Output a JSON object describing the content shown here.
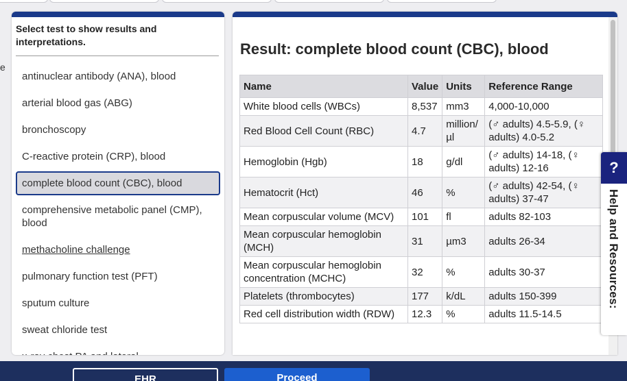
{
  "edge_glyph": "e",
  "left_panel": {
    "heading": "Select test to show results and interpretations.",
    "tests": [
      {
        "label": "antinuclear antibody (ANA), blood"
      },
      {
        "label": "arterial blood gas (ABG)"
      },
      {
        "label": "bronchoscopy"
      },
      {
        "label": "C-reactive protein (CRP), blood"
      },
      {
        "label": "complete blood count (CBC), blood",
        "selected": true
      },
      {
        "label": "comprehensive metabolic panel (CMP), blood"
      },
      {
        "label": "methacholine challenge",
        "underlined": true
      },
      {
        "label": "pulmonary function test (PFT)"
      },
      {
        "label": "sputum culture"
      },
      {
        "label": "sweat chloride test"
      },
      {
        "label": "x-ray chest PA and lateral"
      }
    ]
  },
  "result": {
    "title": "Result: complete blood count (CBC), blood",
    "columns": [
      "Name",
      "Value",
      "Units",
      "Reference Range"
    ],
    "rows": [
      {
        "name": "White blood cells (WBCs)",
        "value": "8,537",
        "units": "mm3",
        "range": "4,000-10,000"
      },
      {
        "name": "Red Blood Cell Count (RBC)",
        "value": "4.7",
        "units": "million/µl",
        "range": "(♂ adults) 4.5-5.9, (♀ adults) 4.0-5.2"
      },
      {
        "name": "Hemoglobin (Hgb)",
        "value": "18",
        "units": "g/dl",
        "range": "(♂ adults) 14-18, (♀ adults) 12-16"
      },
      {
        "name": "Hematocrit (Hct)",
        "value": "46",
        "units": "%",
        "range": "(♂ adults) 42-54, (♀ adults) 37-47"
      },
      {
        "name": "Mean corpuscular volume (MCV)",
        "value": "101",
        "units": "fl",
        "range": "adults 82-103"
      },
      {
        "name": "Mean corpuscular hemoglobin (MCH)",
        "value": "31",
        "units": "µm3",
        "range": "adults 26-34"
      },
      {
        "name": "Mean corpuscular hemoglobin concentration (MCHC)",
        "value": "32",
        "units": "%",
        "range": "adults 30-37"
      },
      {
        "name": "Platelets (thrombocytes)",
        "value": "177",
        "units": "k/dL",
        "range": "adults 150-399"
      },
      {
        "name": "Red cell distribution width (RDW)",
        "value": "12.3",
        "units": "%",
        "range": "adults 11.5-14.5"
      }
    ]
  },
  "help": {
    "icon": "?",
    "label": "Help and Resources:"
  },
  "buttons": {
    "ehr": "EHR",
    "proceed": "Proceed"
  },
  "colors": {
    "accent": "#1a3a8a",
    "help_dark": "#1a237e",
    "proceed": "#1c5fcf",
    "bottom_bar": "#1d2f5e"
  }
}
